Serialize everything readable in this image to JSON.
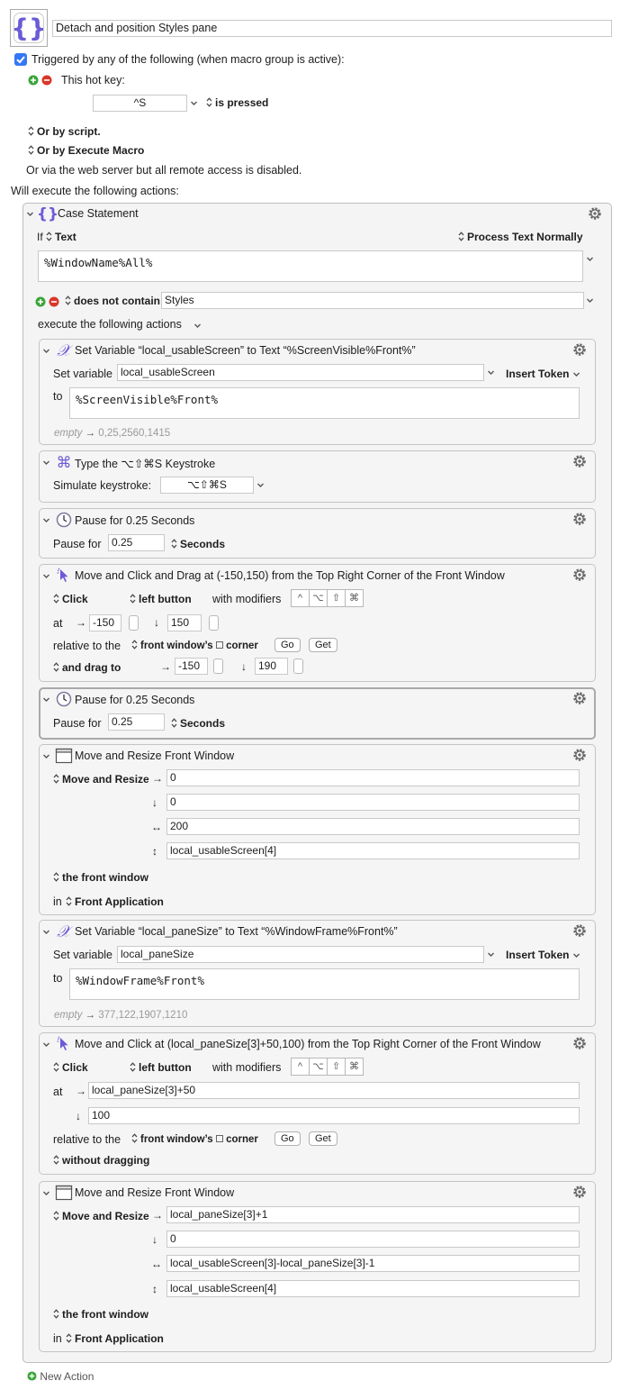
{
  "macro": {
    "title": "Detach and position Styles pane",
    "triggered_label": "Triggered by any of the following (when macro group is active):",
    "hotkey_label": "This hot key:",
    "hotkey_value": "^S",
    "hotkey_state": "is pressed",
    "or_script": "Or by script.",
    "or_execute": "Or by Execute Macro",
    "web_server": "Or via the web server but all remote access is disabled.",
    "will_execute": "Will execute the following actions:",
    "new_action": "New Action"
  },
  "case": {
    "title": "Case Statement",
    "if_label": "If",
    "condition_type": "Text",
    "process": "Process Text Normally",
    "text_value": "%WindowName%All%",
    "operator": "does not contain",
    "compare_value": "Styles",
    "execute_label": "execute the following actions"
  },
  "actions": {
    "a1": {
      "title": "Set Variable “local_usableScreen” to Text “%ScreenVisible%Front%”",
      "set_label": "Set variable",
      "variable": "local_usableScreen",
      "insert_token": "Insert Token",
      "to_label": "to",
      "text": "%ScreenVisible%Front%",
      "preview_empty": "empty",
      "preview_arrow": "→",
      "preview_value": "0,25,2560,1415"
    },
    "a2": {
      "title": "Type the ⌥⇧⌘S Keystroke",
      "simulate_label": "Simulate keystroke:",
      "keystroke": "⌥⇧⌘S"
    },
    "a3": {
      "title": "Pause for 0.25 Seconds",
      "pause_label": "Pause for",
      "value": "0.25",
      "unit": "Seconds"
    },
    "a4": {
      "title": "Move and Click and Drag at (-150,150) from the Top Right Corner of the Front Window",
      "click": "Click",
      "button": "left button",
      "with_modifiers": "with modifiers",
      "at_label": "at",
      "arrow_right": "→",
      "arrow_down": "↓",
      "x": "-150",
      "y": "150",
      "relative_label": "relative to the",
      "relative_value": "front window’s",
      "corner": "corner",
      "go": "Go",
      "get": "Get",
      "drag_label": "and drag to",
      "drag_x": "-150",
      "drag_y": "190"
    },
    "a5": {
      "title": "Pause for 0.25 Seconds",
      "pause_label": "Pause for",
      "value": "0.25",
      "unit": "Seconds"
    },
    "a6": {
      "title": "Move and Resize Front Window",
      "mode": "Move and Resize",
      "arrow_right": "→",
      "arrow_down": "↓",
      "arrow_width": "↔",
      "arrow_height": "↕",
      "left": "0",
      "top": "0",
      "width": "200",
      "height": "local_usableScreen[4]",
      "window": "the front window",
      "in_label": "in",
      "app": "Front Application"
    },
    "a7": {
      "title": "Set Variable “local_paneSize” to Text “%WindowFrame%Front%”",
      "set_label": "Set variable",
      "variable": "local_paneSize",
      "insert_token": "Insert Token",
      "to_label": "to",
      "text": "%WindowFrame%Front%",
      "preview_empty": "empty",
      "preview_arrow": "→",
      "preview_value": "377,122,1907,1210"
    },
    "a8": {
      "title": "Move and Click at (local_paneSize[3]+50,100) from the Top Right Corner of the Front Window",
      "click": "Click",
      "button": "left button",
      "with_modifiers": "with modifiers",
      "at_label": "at",
      "arrow_right": "→",
      "arrow_down": "↓",
      "x": "local_paneSize[3]+50",
      "y": "100",
      "relative_label": "relative to the",
      "relative_value": "front window’s",
      "corner": "corner",
      "go": "Go",
      "get": "Get",
      "drag_label": "without dragging"
    },
    "a9": {
      "title": "Move and Resize Front Window",
      "mode": "Move and Resize",
      "arrow_right": "→",
      "arrow_down": "↓",
      "arrow_width": "↔",
      "arrow_height": "↕",
      "left": "local_paneSize[3]+1",
      "top": "0",
      "width": "local_usableScreen[3]-local_paneSize[3]-1",
      "height": "local_usableScreen[4]",
      "window": "the front window",
      "in_label": "in",
      "app": "Front Application"
    }
  },
  "modifiers": [
    "^",
    "⌥",
    "⇧",
    "⌘"
  ],
  "colors": {
    "accent": "#3478f6",
    "icon_purple": "#6b5bd6",
    "add_green": "#3aa53a",
    "remove_red": "#d9362b"
  }
}
